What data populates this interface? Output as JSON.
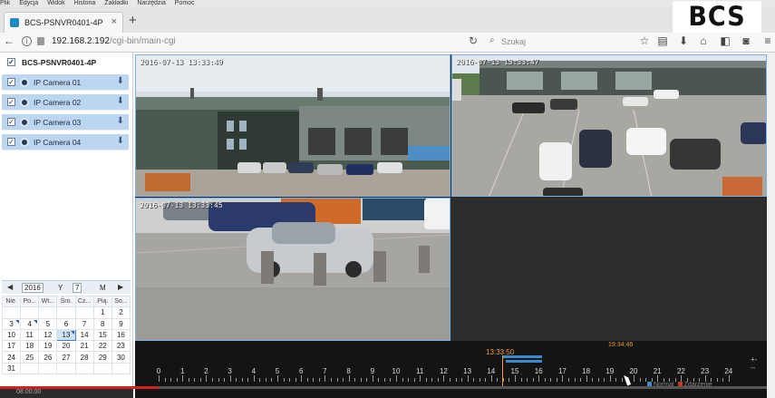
{
  "browser": {
    "menu": [
      "Plik",
      "Edycja",
      "Widok",
      "Historia",
      "Zakładki",
      "Narzędzia",
      "Pomoc"
    ],
    "tab_title": "BCS-PSNVR0401-4P",
    "tab_close": "×",
    "new_tab": "+",
    "url_host": "192.168.2.192",
    "url_path": "/cgi-bin/main-cgi",
    "search_placeholder": "Szukaj"
  },
  "logo_text": "BCS",
  "device": {
    "name": "BCS-PSNVR0401-4P",
    "cameras": [
      {
        "label": "IP Camera 01"
      },
      {
        "label": "IP Camera 02"
      },
      {
        "label": "IP Camera 03"
      },
      {
        "label": "IP Camera 04"
      }
    ]
  },
  "calendar": {
    "year": "2016",
    "year_label": "Y",
    "month": "7",
    "month_label": "M",
    "weekdays": [
      "Nie.",
      "Po...",
      "Wt...",
      "Śro.",
      "Cz...",
      "Pią.",
      "So..."
    ],
    "weeks": [
      [
        "",
        "",
        "",
        "",
        "",
        "1",
        "2"
      ],
      [
        "3",
        "4",
        "5",
        "6",
        "7",
        "8",
        "9"
      ],
      [
        "10",
        "11",
        "12",
        "13",
        "14",
        "15",
        "16"
      ],
      [
        "17",
        "18",
        "19",
        "20",
        "21",
        "22",
        "23"
      ],
      [
        "24",
        "25",
        "26",
        "27",
        "28",
        "29",
        "30"
      ],
      [
        "31",
        "",
        "",
        "",
        "",
        "",
        ""
      ]
    ],
    "selected_day": "13",
    "days_with_recordings": [
      "3",
      "4",
      "13"
    ],
    "clock": "08:00:00"
  },
  "video": {
    "osd": [
      "2016-07-13 13:33:49",
      "2016-07-13 13:33:47",
      "2016-07-13 13:33:45"
    ]
  },
  "timeline": {
    "hours": [
      "0",
      "1",
      "2",
      "3",
      "4",
      "5",
      "6",
      "7",
      "8",
      "9",
      "10",
      "11",
      "12",
      "13",
      "14",
      "15",
      "16",
      "17",
      "18",
      "19",
      "20",
      "21",
      "22",
      "23",
      "24"
    ],
    "current_time": "13:33:50",
    "end_time": "19:34:46",
    "legend_normal": "Normal",
    "legend_event": "Zdarzenie",
    "zoom_in": "+-",
    "zoom_out": "--"
  },
  "colors": {
    "selection": "#bdd6f0",
    "record_marker": "#3a8ad0",
    "current_time": "#e8a030",
    "progress": "#d12020"
  }
}
